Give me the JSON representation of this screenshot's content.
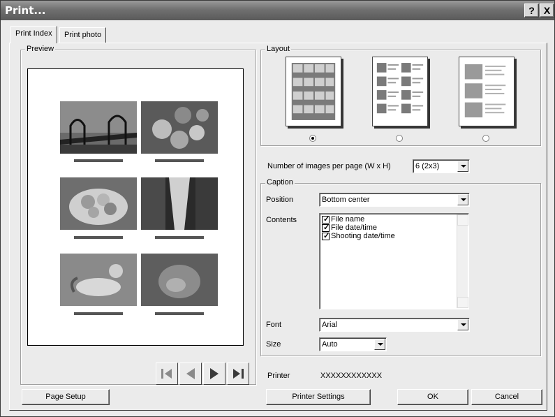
{
  "window": {
    "title": "Print...",
    "help_label": "?",
    "close_label": "X"
  },
  "tabs": [
    {
      "label": "Print Index"
    },
    {
      "label": "Print photo"
    }
  ],
  "preview": {
    "legend": "Preview"
  },
  "layout": {
    "legend": "Layout",
    "selected_index": 0,
    "options": [
      "grid-thumbnails",
      "thumbnails-with-text",
      "large-with-text"
    ]
  },
  "images_per_page": {
    "label": "Number of images per page (W x H)",
    "value": "6 (2x3)"
  },
  "caption": {
    "legend": "Caption",
    "position_label": "Position",
    "position_value": "Bottom center",
    "contents_label": "Contents",
    "contents_items": [
      {
        "label": "File name",
        "checked": true
      },
      {
        "label": "File date/time",
        "checked": true
      },
      {
        "label": "Shooting date/time",
        "checked": true
      }
    ],
    "font_label": "Font",
    "font_value": "Arial",
    "size_label": "Size",
    "size_value": "Auto"
  },
  "printer": {
    "label": "Printer",
    "value": "XXXXXXXXXXXX"
  },
  "buttons": {
    "page_setup": "Page Setup",
    "printer_settings": "Printer Settings",
    "ok": "OK",
    "cancel": "Cancel"
  },
  "navigation": [
    "first-page-icon",
    "prev-page-icon",
    "next-page-icon",
    "last-page-icon"
  ],
  "colors": {
    "titlebar": "#707070",
    "dialog_bg": "#ebebeb"
  }
}
